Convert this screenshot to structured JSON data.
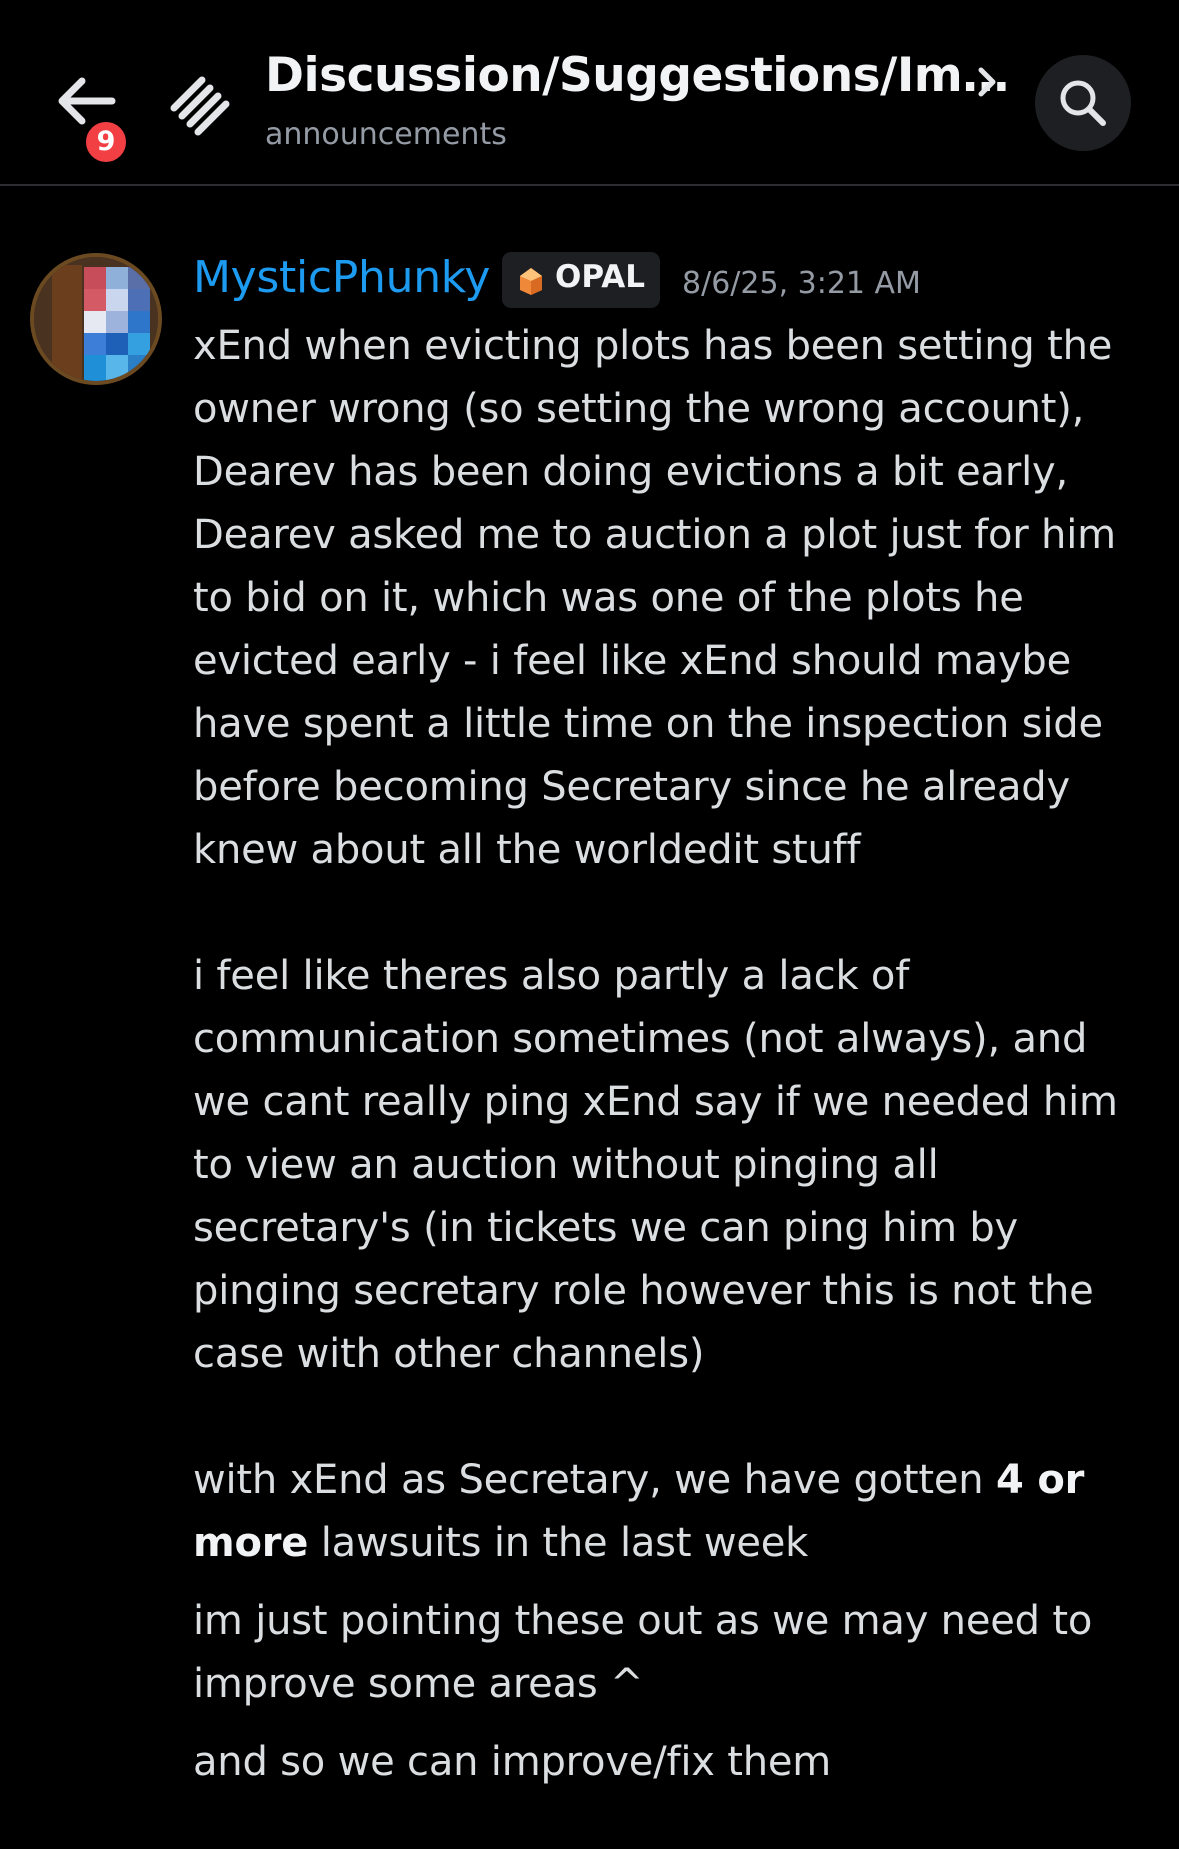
{
  "header": {
    "notification_count": "9",
    "title": "Discussion/Suggestions/Im…",
    "subtitle": "announcements",
    "icons": {
      "back": "arrow-left-icon",
      "forum": "forum-stack-icon",
      "chevron": "chevron-right-icon",
      "search": "search-icon"
    }
  },
  "message": {
    "author": "MysticPhunky",
    "tag": {
      "icon": "opal-gem-icon",
      "label": "OPAL"
    },
    "timestamp": "8/6/25, 3:21 AM",
    "paragraphs": {
      "p1": [
        "xEnd when evicting plots has been setting the",
        "owner wrong (so setting the wrong account),",
        "Dearev has been doing evictions a bit early,",
        "Dearev asked me to auction a plot just for him",
        "to bid on it, which was one of the plots he",
        "evicted early - i feel like xEnd should maybe",
        "have spent a little time on the inspection side",
        "before becoming Secretary since he already",
        "knew about all the worldedit stuff"
      ],
      "p2": [
        "i feel like theres also partly a lack of",
        "communication sometimes (not always), and",
        "we cant really ping xEnd say if we needed him",
        "to view an auction without pinging all",
        "secretary's (in tickets we can ping him by",
        "pinging secretary role however this is not the",
        "case with other channels)"
      ],
      "p3": {
        "before_bold": "with xEnd as Secretary, we have gotten ",
        "bold_1": "4 or",
        "bold_2": "more",
        "after_bold": " lawsuits in the last week"
      },
      "p4": [
        "im just pointing these out as we may need to",
        "improve some areas ^"
      ],
      "p5": "and so we can improve/fix them"
    }
  }
}
